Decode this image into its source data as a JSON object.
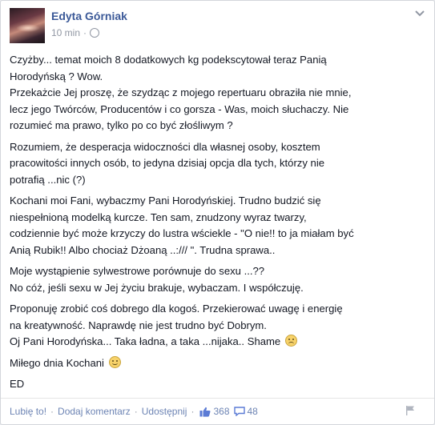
{
  "post": {
    "author": "Edyta Górniak",
    "time": "10 min",
    "sep": "·",
    "body": {
      "p1": [
        "Czyżby... temat moich 8 dodatkowych kg podekscytował teraz Panią",
        "Horodyńską ? Wow.",
        "Przekażcie Jej proszę, że szydząc z mojego repertuaru obraziła nie mnie,",
        "lecz jego Twórców, Producentów i co gorsza - Was, moich słuchaczy. Nie",
        "rozumieć ma prawo, tylko po co być złośliwym ?"
      ],
      "p2": [
        "Rozumiem, że desperacja widoczności dla własnej osoby, kosztem",
        "pracowitości innych osób, to jedyna dzisiaj opcja dla tych, którzy nie",
        "potrafią ...nic (?)"
      ],
      "p3": [
        "Kochani moi Fani, wybaczmy Pani Horodyńskiej. Trudno budzić się",
        "niespełnioną modelką kurcze. Ten sam, znudzony wyraz twarzy,",
        "codziennie być może krzyczy do lustra wściekle - \"O nie!! to ja miałam być",
        "Anią Rubik!! Albo chociaż Dżoaną ..:/// \". Trudna sprawa.."
      ],
      "p4": [
        "Moje wystąpienie sylwestrowe porównuje do sexu ...??",
        "No cóż, jeśli sexu w Jej życiu brakuje, wybaczam. I współczuję."
      ],
      "p5": [
        "Proponuję zrobić coś dobrego dla kogoś. Przekierować uwagę i energię",
        "na kreatywność. Naprawdę nie jest trudno być Dobrym.",
        "Oj Pani Horodyńska... Taka ładna, a taka ...nijaka.. Shame"
      ],
      "p6": "Miłego dnia Kochani",
      "p7": "ED"
    }
  },
  "footer": {
    "like": "Lubię to!",
    "comment": "Dodaj komentarz",
    "share": "Udostępnij",
    "dot": "·",
    "likes_count": "368",
    "comments_count": "48"
  },
  "icons": {
    "header_menu": "chevron-down-icon",
    "privacy": "globe-icon",
    "likes": "thumbs-up-icon",
    "comments": "comment-bubble-icon",
    "report": "flag-icon",
    "emoji_sad": "frown-emoji-icon",
    "emoji_smile": "smile-emoji-icon"
  },
  "colors": {
    "link": "#3b5998",
    "muted": "#9197a3",
    "action": "#6d84b4"
  }
}
